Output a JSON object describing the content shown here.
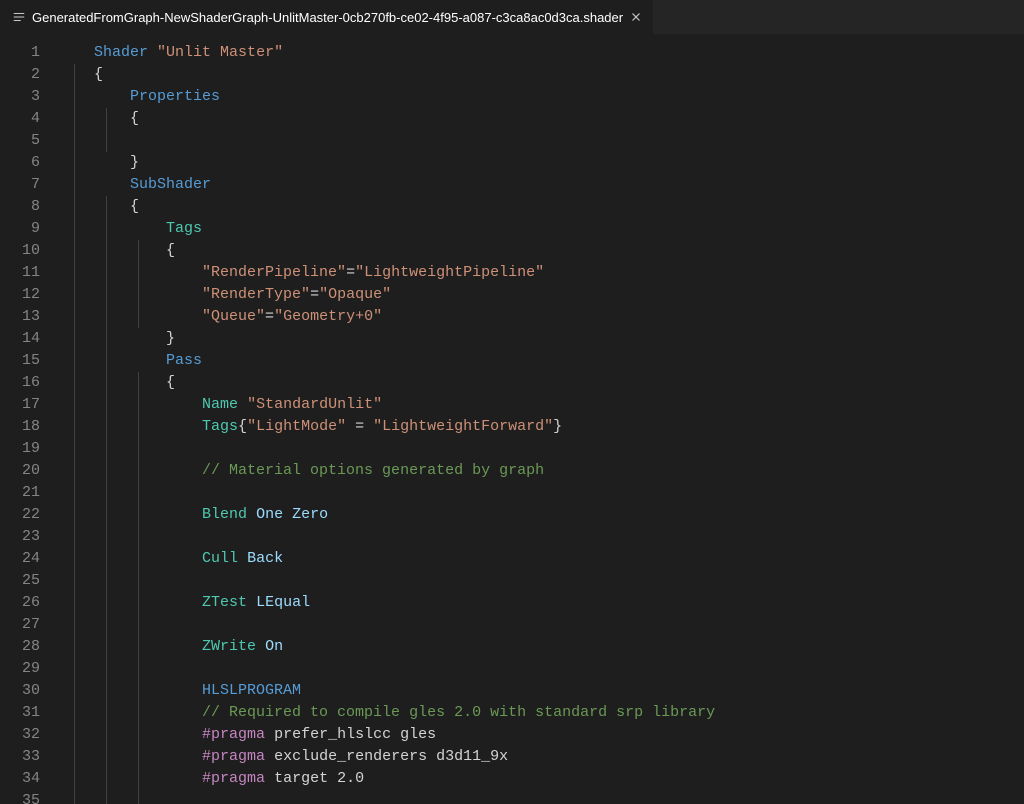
{
  "tab": {
    "filename": "GeneratedFromGraph-NewShaderGraph-UnlitMaster-0cb270fb-ce02-4f95-a087-c3ca8ac0d3ca.shader"
  },
  "lineCount": 35,
  "code": {
    "l1": {
      "kw": "Shader",
      "str": "\"Unlit Master\""
    },
    "l2": {
      "txt": "{"
    },
    "l3": {
      "kw": "Properties"
    },
    "l4": {
      "txt": "{"
    },
    "l5": {
      "txt": ""
    },
    "l6": {
      "txt": "}"
    },
    "l7": {
      "kw": "SubShader"
    },
    "l8": {
      "txt": "{"
    },
    "l9": {
      "type": "Tags"
    },
    "l10": {
      "txt": "{"
    },
    "l11": {
      "k": "\"RenderPipeline\"",
      "eq": "=",
      "v": "\"LightweightPipeline\""
    },
    "l12": {
      "k": "\"RenderType\"",
      "eq": "=",
      "v": "\"Opaque\""
    },
    "l13": {
      "k": "\"Queue\"",
      "eq": "=",
      "v": "\"Geometry+0\""
    },
    "l14": {
      "txt": "}"
    },
    "l15": {
      "kw": "Pass"
    },
    "l16": {
      "txt": "{"
    },
    "l17": {
      "type": "Name",
      "str": "\"StandardUnlit\""
    },
    "l18": {
      "type": "Tags",
      "open": "{",
      "k": "\"LightMode\"",
      "eq": " = ",
      "v": "\"LightweightForward\"",
      "close": "}"
    },
    "l19": {
      "txt": ""
    },
    "l20": {
      "com": "// Material options generated by graph"
    },
    "l21": {
      "txt": ""
    },
    "l22": {
      "type": "Blend",
      "arg1": "One",
      "arg2": "Zero"
    },
    "l23": {
      "txt": ""
    },
    "l24": {
      "type": "Cull",
      "arg1": "Back"
    },
    "l25": {
      "txt": ""
    },
    "l26": {
      "type": "ZTest",
      "arg1": "LEqual"
    },
    "l27": {
      "txt": ""
    },
    "l28": {
      "type": "ZWrite",
      "arg1": "On"
    },
    "l29": {
      "txt": ""
    },
    "l30": {
      "kw": "HLSLPROGRAM"
    },
    "l31": {
      "com": "// Required to compile gles 2.0 with standard srp library"
    },
    "l32": {
      "dir": "#pragma",
      "rest": "prefer_hlslcc gles"
    },
    "l33": {
      "dir": "#pragma",
      "rest": "exclude_renderers d3d11_9x"
    },
    "l34": {
      "dir": "#pragma",
      "rest": "target 2.0"
    },
    "l35": {
      "txt": ""
    }
  }
}
